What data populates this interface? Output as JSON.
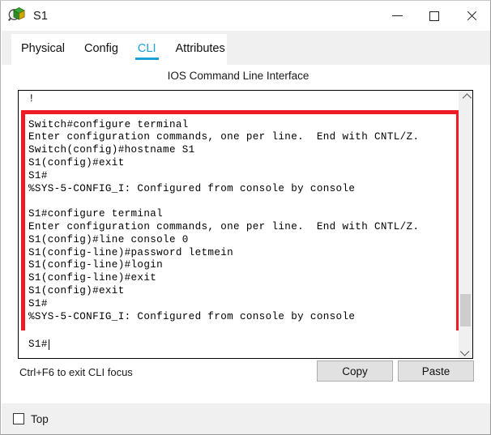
{
  "window": {
    "title": "S1",
    "icon": "switch-icon",
    "minimize_label": "Minimize",
    "maximize_label": "Maximize",
    "close_label": "Close"
  },
  "tabs": [
    {
      "label": "Physical",
      "active": false
    },
    {
      "label": "Config",
      "active": false
    },
    {
      "label": "CLI",
      "active": true
    },
    {
      "label": "Attributes",
      "active": false
    }
  ],
  "panel": {
    "heading": "IOS Command Line Interface"
  },
  "terminal": {
    "output": "!\n\nSwitch#configure terminal\nEnter configuration commands, one per line.  End with CNTL/Z.\nSwitch(config)#hostname S1\nS1(config)#exit\nS1#\n%SYS-5-CONFIG_I: Configured from console by console\n\nS1#configure terminal\nEnter configuration commands, one per line.  End with CNTL/Z.\nS1(config)#line console 0\nS1(config-line)#password letmein\nS1(config-line)#login\nS1(config-line)#exit\nS1(config)#exit\nS1#\n%SYS-5-CONFIG_I: Configured from console by console",
    "prompt": "S1#",
    "scroll_up_icon": "chevron-up-icon",
    "scroll_down_icon": "chevron-down-icon",
    "annotation_color": "#ed1c24"
  },
  "footer": {
    "hint": "Ctrl+F6 to exit CLI focus",
    "copy_label": "Copy",
    "paste_label": "Paste"
  },
  "bottom": {
    "top_checkbox_label": "Top",
    "top_checked": false
  },
  "colors": {
    "accent": "#1ba1d6",
    "annotation": "#ed1c24",
    "window_chrome": "#f0f0f0",
    "button_face": "#e1e1e1"
  }
}
